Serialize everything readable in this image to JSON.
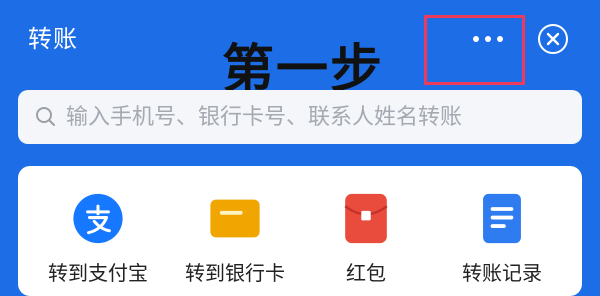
{
  "header": {
    "title": "转账",
    "more_icon": "more-horizontal-icon",
    "close_icon": "close-circle-icon"
  },
  "overlay_text": "第一步",
  "search": {
    "placeholder": "输入手机号、银行卡号、联系人姓名转账",
    "icon": "search-icon"
  },
  "actions": [
    {
      "label": "转到支付宝",
      "icon": "alipay-icon",
      "color": "#1677ff"
    },
    {
      "label": "转到银行卡",
      "icon": "bank-card-icon",
      "color": "#f0a500"
    },
    {
      "label": "红包",
      "icon": "red-packet-icon",
      "color": "#e94b3c"
    },
    {
      "label": "转账记录",
      "icon": "transfer-record-icon",
      "color": "#2f7bf0"
    }
  ],
  "colors": {
    "background": "#1d6ee6",
    "highlight": "#ef3b5b",
    "search_bg": "#f4f6f9",
    "text_primary": "#222222",
    "placeholder": "#a4a9b2"
  }
}
